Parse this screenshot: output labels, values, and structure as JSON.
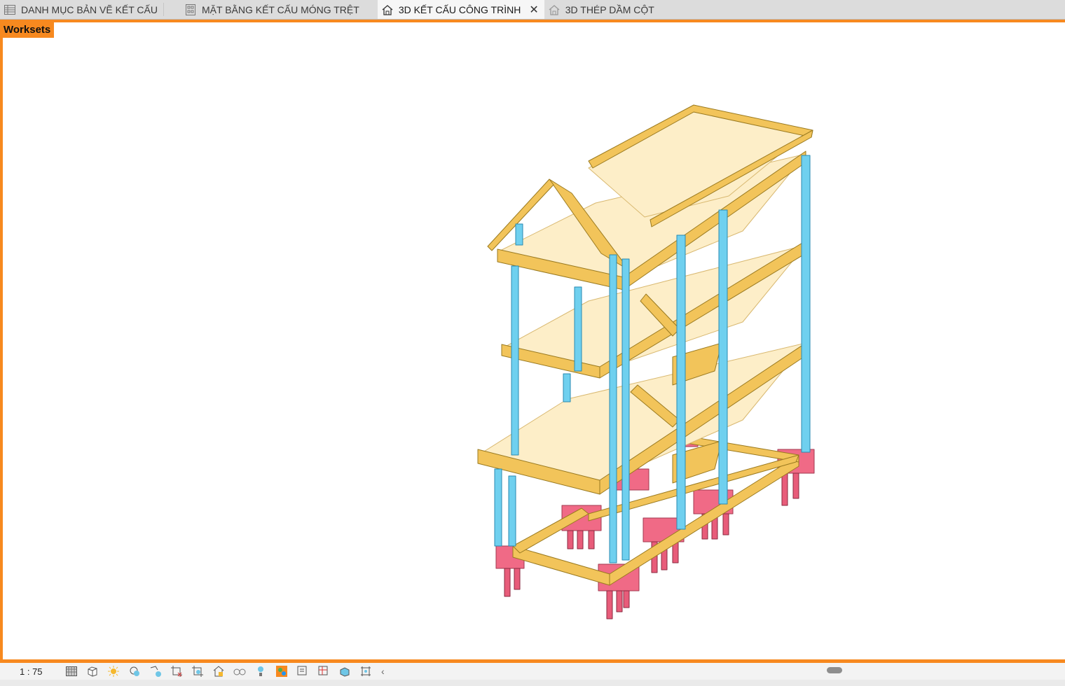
{
  "tabs": [
    {
      "label": "DANH MỤC BẢN VẼ KẾT CẤU",
      "icon": "schedule-icon",
      "active": false
    },
    {
      "label": "MẶT BẰNG KẾT CẤU MÓNG TRỆT",
      "icon": "floor-plan-icon",
      "active": false
    },
    {
      "label": "3D KẾT CẤU CÔNG TRÌNH",
      "icon": "3d-view-icon",
      "active": true
    },
    {
      "label": "3D THÉP DẦM CỘT",
      "icon": "3d-view-icon",
      "active": false
    }
  ],
  "worksets_label": "Worksets",
  "status_bar": {
    "scale": "1 : 75",
    "controls": [
      "detail-level-icon",
      "visual-style-icon",
      "sun-path-icon",
      "shadows-icon",
      "render-icon",
      "crop-view-icon",
      "show-crop-icon",
      "unlock-3d-view-icon",
      "temporary-hide-icon",
      "reveal-hidden-icon",
      "worksharing-display-icon",
      "temporary-view-properties-icon",
      "analytical-model-icon",
      "highlight-displacement-icon",
      "reveal-constraints-icon"
    ]
  },
  "colors": {
    "accent": "#f7891f",
    "slab": "#fdeec8",
    "beam": "#f2c45a",
    "column": "#6fd0ef",
    "foundation": "#f06a86"
  }
}
